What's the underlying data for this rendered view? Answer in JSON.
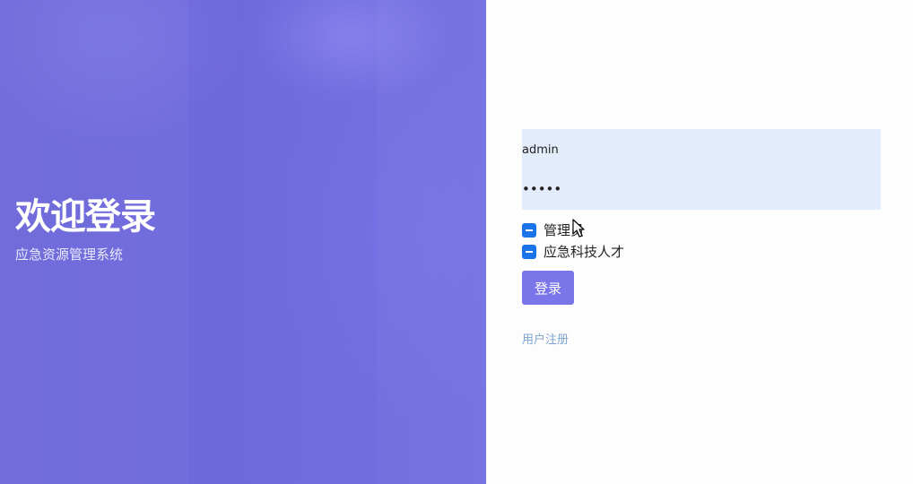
{
  "hero": {
    "title": "欢迎登录",
    "subtitle": "应急资源管理系统"
  },
  "login_form": {
    "username_value": "admin",
    "password_value": "•••••",
    "roles": [
      {
        "label": "管理员",
        "state": "indeterminate"
      },
      {
        "label": "应急科技人才",
        "state": "indeterminate"
      }
    ],
    "login_button_label": "登录",
    "register_link_label": "用户注册"
  },
  "colors": {
    "hero_background": "#6e69dc",
    "accent": "#7b75ea",
    "input_background": "#e3ecfa",
    "checkbox": "#1a73e8",
    "link": "#7da2cf"
  }
}
